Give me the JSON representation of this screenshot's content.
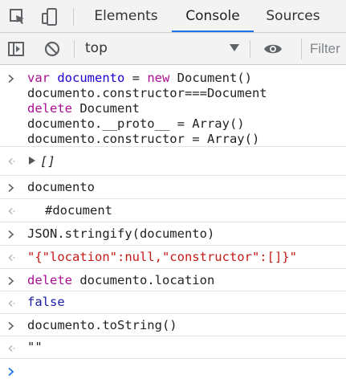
{
  "tabs": {
    "elements": "Elements",
    "console": "Console",
    "sources": "Sources"
  },
  "toolbar": {
    "context": "top",
    "filter_placeholder": "Filter"
  },
  "console": {
    "entry1": {
      "line1": {
        "kw1": "var",
        "id1": "documento",
        "eq": " = ",
        "kw2": "new",
        "rest": " Document()"
      },
      "line2": "documento.constructor===Document",
      "line3": {
        "kw": "delete",
        "rest": " Document"
      },
      "line4": "documento.__proto__ = Array()",
      "line5": "documento.constructor = Array()"
    },
    "result1": "[]",
    "entry2": "documento",
    "result2": "#document",
    "entry3": "JSON.stringify(documento)",
    "result3": "\"{\"location\":null,\"constructor\":[]}\"",
    "entry4": {
      "kw": "delete",
      "rest": " documento.location"
    },
    "result4": "false",
    "entry5": "documento.toString()",
    "result5": "\"\""
  },
  "colors": {
    "accent": "#1a73e8",
    "keyword": "#aa0d91",
    "string": "#c41a16",
    "boolean": "#1a1aa6"
  }
}
